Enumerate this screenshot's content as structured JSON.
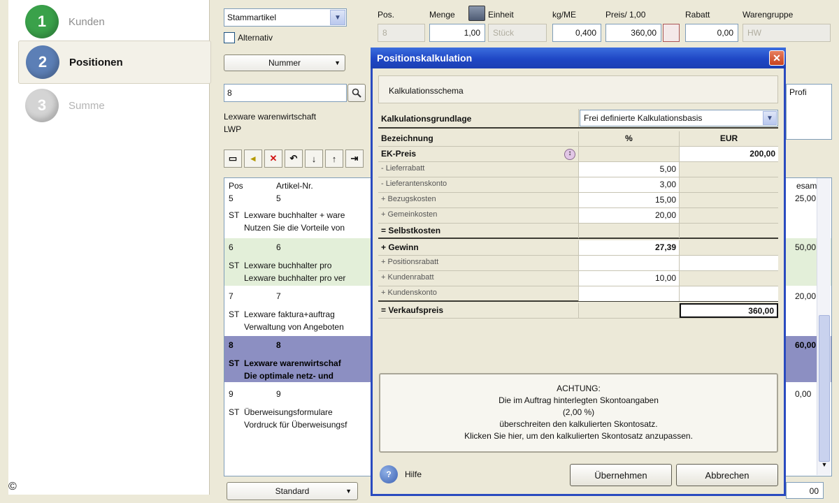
{
  "wizard": {
    "steps": [
      {
        "number": "1",
        "label": "Kunden",
        "color": "#3aa14a"
      },
      {
        "number": "2",
        "label": "Positionen",
        "color": "#5c7fb6"
      },
      {
        "number": "3",
        "label": "Summe",
        "color": "#c6c6c6"
      }
    ]
  },
  "form": {
    "article_type": "Stammartikel",
    "alternative_label": "Alternativ",
    "search_by": "Nummer",
    "search_value": "8",
    "article_name": "Lexware warenwirtschaft",
    "article_code": "LWP",
    "headers": {
      "pos": "Pos.",
      "menge": "Menge",
      "einheit": "Einheit",
      "kg_me": "kg/ME",
      "preis": "Preis/ 1,00",
      "rabatt": "Rabatt",
      "warengruppe": "Warengruppe"
    },
    "values": {
      "pos": "8",
      "menge": "1,00",
      "einheit": "Stück",
      "kg_me": "0,400",
      "preis": "360,00",
      "rabatt": "0,00",
      "warengruppe": "HW"
    },
    "profi_label": "Profi",
    "bottom_select": "Standard"
  },
  "list": {
    "headers": {
      "pos": "Pos",
      "artikel": "Artikel-Nr.",
      "gesamt": "esamt"
    },
    "rows": [
      {
        "pos": "5",
        "nr": "5",
        "type": "ST",
        "line1": "Lexware buchhalter + ware",
        "line2": "Nutzen Sie die Vorteile von",
        "total": "25,00"
      },
      {
        "pos": "6",
        "nr": "6",
        "type": "ST",
        "line1": "Lexware buchhalter pro",
        "line2": "Lexware buchhalter pro ver",
        "total": "50,00"
      },
      {
        "pos": "7",
        "nr": "7",
        "type": "ST",
        "line1": "Lexware faktura+auftrag",
        "line2": "Verwaltung von Angeboten",
        "total": "20,00"
      },
      {
        "pos": "8",
        "nr": "8",
        "type": "ST",
        "line1": "Lexware warenwirtschaf",
        "line2": "Die optimale netz- und",
        "total": "60,00"
      },
      {
        "pos": "9",
        "nr": "9",
        "type": "ST",
        "line1": "Überweisungsformulare",
        "line2": "Vordruck für Überweisungsf",
        "total": "0,00"
      }
    ]
  },
  "dialog": {
    "title": "Positionskalkulation",
    "close_glyph": "✕",
    "schema_label": "Kalkulationsschema",
    "basis_label": "Kalkulationsgrundlage",
    "basis_value": "Frei definierte Kalkulationsbasis",
    "col_name": "Bezeichnung",
    "col_pct": "%",
    "col_eur": "EUR",
    "rows": [
      {
        "name": "EK-Preis",
        "pct": "",
        "eur": "200,00",
        "bold": true
      },
      {
        "name": "- Lieferrabatt",
        "pct": "5,00",
        "eur": ""
      },
      {
        "name": "- Lieferantenskonto",
        "pct": "3,00",
        "eur": ""
      },
      {
        "name": "+ Bezugskosten",
        "pct": "15,00",
        "eur": ""
      },
      {
        "name": "+ Gemeinkosten",
        "pct": "20,00",
        "eur": ""
      },
      {
        "name": "= Selbstkosten",
        "pct": "",
        "eur": "",
        "bold": true
      },
      {
        "name": "+ Gewinn",
        "pct": "27,39",
        "eur": "",
        "bold": true
      },
      {
        "name": "+ Positionsrabatt",
        "pct": "",
        "eur": ""
      },
      {
        "name": "+ Kundenrabatt",
        "pct": "10,00",
        "eur": ""
      },
      {
        "name": "+ Kundenskonto",
        "pct": "",
        "eur": ""
      },
      {
        "name": "= Verkaufspreis",
        "pct": "",
        "eur": "360,00",
        "bold": true
      }
    ],
    "warning": {
      "title": "ACHTUNG:",
      "line1": "Die im Auftrag hinterlegten Skontoangaben",
      "line2": "(2,00 %)",
      "line3": "überschreiten den kalkulierten Skontosatz.",
      "line4": "Klicken Sie hier, um den kalkulierten Skontosatz anzupassen."
    },
    "help_label": "Hilfe",
    "apply_label": "Übernehmen",
    "cancel_label": "Abbrechen"
  },
  "footer": {
    "copyright": "©",
    "right_value": "00"
  }
}
